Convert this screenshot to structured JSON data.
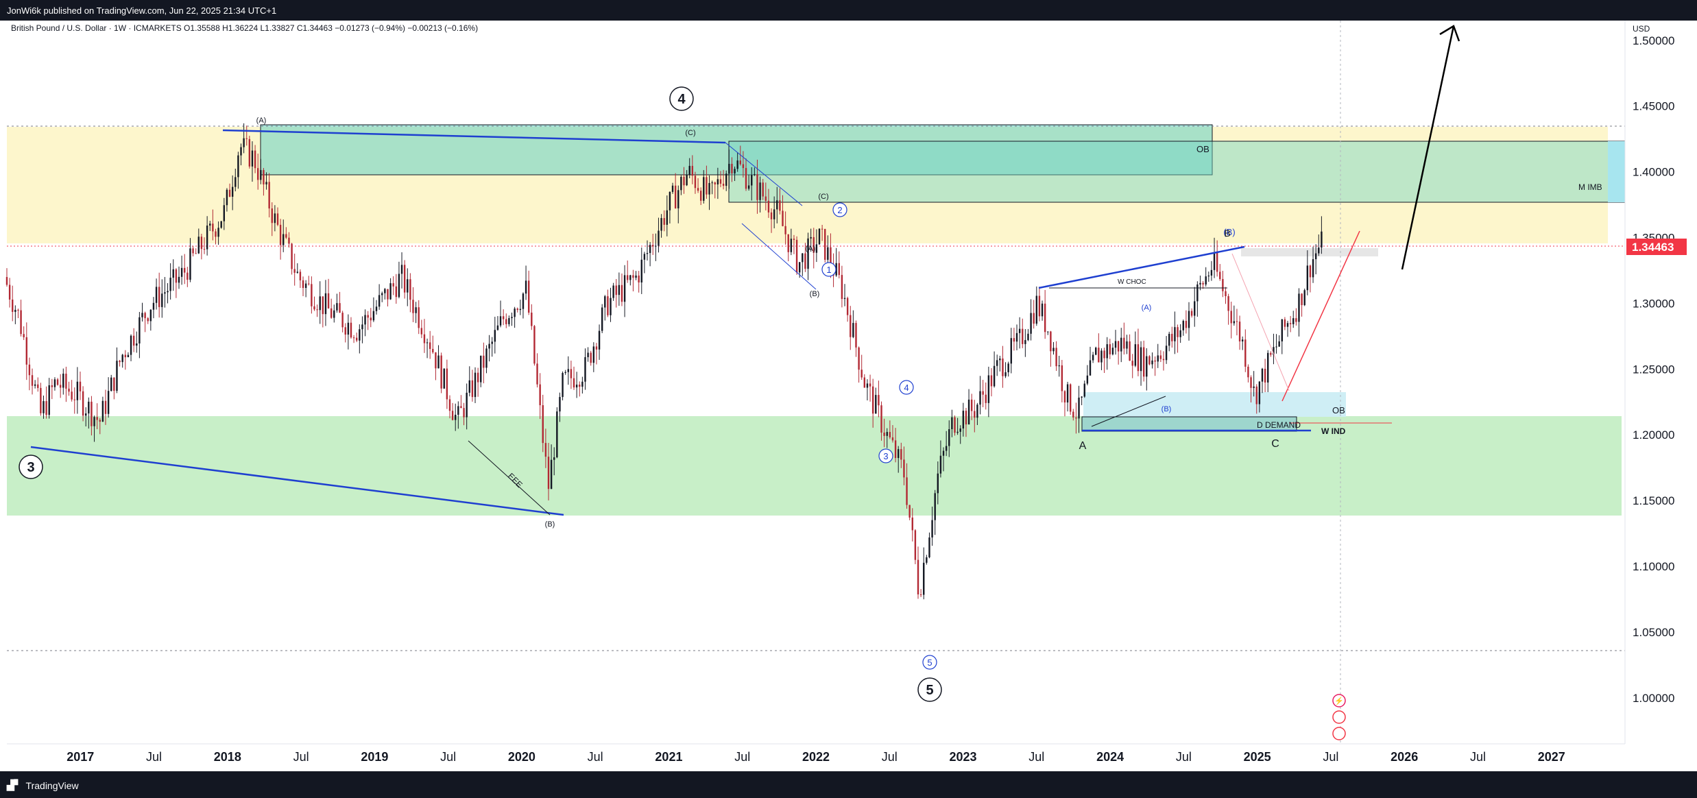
{
  "header": {
    "publish_text": "JonWi6k published on TradingView.com, Jun 22, 2025 21:34 UTC+1"
  },
  "legend": {
    "text": "British Pound / U.S. Dollar · 1W · ICMARKETS  O1.35588  H1.36224  L1.33827  C1.34463  −0.01273 (−0.94%)  −0.00213 (−0.16%)"
  },
  "footer": {
    "brand": "TradingView"
  },
  "price_axis": {
    "currency": "USD",
    "last_price": "1.34463"
  },
  "colors": {
    "up": "#131722",
    "down": "#b22833",
    "last_price": "#f23645",
    "support_zone": "#c8efc8",
    "resistance_zone": "#fdf6cc",
    "ob_zone": "#70d4c4",
    "elliott_blue": "#1e3fd0"
  },
  "annotations": {
    "major_waves": [
      "3",
      "4",
      "5"
    ],
    "minor_waves": [
      "1",
      "2",
      "3",
      "4",
      "5"
    ],
    "corrections": [
      "(A)",
      "(B)",
      "(C)",
      "(A)",
      "(B)",
      "(C)",
      "(A)",
      "(B)",
      "(B)"
    ],
    "abc": [
      "A",
      "B",
      "C"
    ],
    "labels": {
      "ob": "OB",
      "m_imb": "M IMB",
      "w_choc": "W CHOC",
      "d_demand": "D DEMAND",
      "w_ind": "W IND",
      "eee": "EEE",
      "ob2": "OB"
    },
    "icons": [
      "flash-icon",
      "flag-icon",
      "flag-icon"
    ]
  },
  "chart_data": {
    "type": "candlestick",
    "symbol": "British Pound / U.S. Dollar",
    "timeframe": "1W",
    "exchange": "ICMARKETS",
    "ohlc_last": {
      "open": 1.35588,
      "high": 1.36224,
      "low": 1.33827,
      "close": 1.34463,
      "change": -0.01273,
      "change_pct": -0.94
    },
    "y_axis": {
      "range": [
        0.965,
        1.515
      ],
      "ticks": [
        "1.00000",
        "1.05000",
        "1.10000",
        "1.15000",
        "1.20000",
        "1.25000",
        "1.30000",
        "1.35000",
        "1.40000",
        "1.45000",
        "1.50000"
      ]
    },
    "x_axis": {
      "range": [
        2016.5,
        2027.5
      ],
      "ticks": [
        {
          "label": "2017",
          "x": 2017.0,
          "bold": true
        },
        {
          "label": "Jul",
          "x": 2017.5,
          "bold": false
        },
        {
          "label": "2018",
          "x": 2018.0,
          "bold": true
        },
        {
          "label": "Jul",
          "x": 2018.5,
          "bold": false
        },
        {
          "label": "2019",
          "x": 2019.0,
          "bold": true
        },
        {
          "label": "Jul",
          "x": 2019.5,
          "bold": false
        },
        {
          "label": "2020",
          "x": 2020.0,
          "bold": true
        },
        {
          "label": "Jul",
          "x": 2020.5,
          "bold": false
        },
        {
          "label": "2021",
          "x": 2021.0,
          "bold": true
        },
        {
          "label": "Jul",
          "x": 2021.5,
          "bold": false
        },
        {
          "label": "2022",
          "x": 2022.0,
          "bold": true
        },
        {
          "label": "Jul",
          "x": 2022.5,
          "bold": false
        },
        {
          "label": "2023",
          "x": 2023.0,
          "bold": true
        },
        {
          "label": "Jul",
          "x": 2023.5,
          "bold": false
        },
        {
          "label": "2024",
          "x": 2024.0,
          "bold": true
        },
        {
          "label": "Jul",
          "x": 2024.5,
          "bold": false
        },
        {
          "label": "2025",
          "x": 2025.0,
          "bold": true
        },
        {
          "label": "Jul",
          "x": 2025.5,
          "bold": false
        },
        {
          "label": "2026",
          "x": 2026.0,
          "bold": true
        },
        {
          "label": "Jul",
          "x": 2026.5,
          "bold": false
        },
        {
          "label": "2027",
          "x": 2027.0,
          "bold": true
        }
      ]
    },
    "price_path": [
      [
        2016.5,
        1.32
      ],
      [
        2016.6,
        1.29
      ],
      [
        2016.68,
        1.25
      ],
      [
        2016.75,
        1.215
      ],
      [
        2016.85,
        1.24
      ],
      [
        2017.0,
        1.23
      ],
      [
        2017.15,
        1.21
      ],
      [
        2017.3,
        1.26
      ],
      [
        2017.5,
        1.3
      ],
      [
        2017.7,
        1.32
      ],
      [
        2017.85,
        1.345
      ],
      [
        2018.0,
        1.37
      ],
      [
        2018.1,
        1.42
      ],
      [
        2018.2,
        1.41
      ],
      [
        2018.35,
        1.36
      ],
      [
        2018.5,
        1.32
      ],
      [
        2018.7,
        1.295
      ],
      [
        2018.9,
        1.28
      ],
      [
        2019.05,
        1.3
      ],
      [
        2019.2,
        1.32
      ],
      [
        2019.4,
        1.27
      ],
      [
        2019.58,
        1.21
      ],
      [
        2019.7,
        1.24
      ],
      [
        2019.9,
        1.29
      ],
      [
        2020.05,
        1.31
      ],
      [
        2020.2,
        1.16
      ],
      [
        2020.3,
        1.24
      ],
      [
        2020.45,
        1.25
      ],
      [
        2020.6,
        1.3
      ],
      [
        2020.8,
        1.32
      ],
      [
        2021.0,
        1.37
      ],
      [
        2021.15,
        1.4
      ],
      [
        2021.3,
        1.38
      ],
      [
        2021.45,
        1.41
      ],
      [
        2021.6,
        1.39
      ],
      [
        2021.75,
        1.37
      ],
      [
        2021.9,
        1.33
      ],
      [
        2022.05,
        1.35
      ],
      [
        2022.2,
        1.31
      ],
      [
        2022.35,
        1.24
      ],
      [
        2022.5,
        1.2
      ],
      [
        2022.62,
        1.17
      ],
      [
        2022.72,
        1.08
      ],
      [
        2022.85,
        1.17
      ],
      [
        2022.95,
        1.21
      ],
      [
        2023.1,
        1.22
      ],
      [
        2023.25,
        1.25
      ],
      [
        2023.4,
        1.27
      ],
      [
        2023.52,
        1.3
      ],
      [
        2023.6,
        1.28
      ],
      [
        2023.72,
        1.23
      ],
      [
        2023.8,
        1.215
      ],
      [
        2023.92,
        1.26
      ],
      [
        2024.1,
        1.27
      ],
      [
        2024.25,
        1.255
      ],
      [
        2024.38,
        1.265
      ],
      [
        2024.5,
        1.28
      ],
      [
        2024.62,
        1.31
      ],
      [
        2024.72,
        1.33
      ],
      [
        2024.82,
        1.3
      ],
      [
        2024.92,
        1.27
      ],
      [
        2025.0,
        1.23
      ],
      [
        2025.08,
        1.25
      ],
      [
        2025.2,
        1.28
      ],
      [
        2025.3,
        1.3
      ],
      [
        2025.38,
        1.33
      ],
      [
        2025.45,
        1.345
      ]
    ]
  }
}
